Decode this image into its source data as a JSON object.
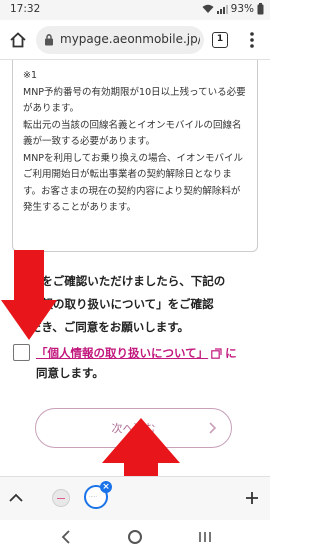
{
  "status_bar": {
    "time": "17:32",
    "battery": "93%"
  },
  "browser": {
    "url": "mypage.aeonmobile.jp/r",
    "tab_count": "1"
  },
  "notice": {
    "lines": [
      "※1",
      "MNP予約番号の有効期限が10日以上残っている必要があります。",
      "転出元の当該の回線名義とイオンモバイルの回線名義が一致する必要があります。",
      "MNPを利用してお乗り換えの場合、イオンモバイルご利用開始日が転出事業者の契約解除日となります。お客さまの現在の契約内容により契約解除料が発生することがあります。"
    ]
  },
  "consent": {
    "lead_text": "てをご確認いただけましたら、下記の\n情報の取り扱いについて」をご確認\nだき、ご同意をお願いします。",
    "link_text": "「個人情報の取り扱いについて」",
    "agree_prefix": "に",
    "agree_suffix": "同意します。",
    "checkbox_checked": false
  },
  "next_button": {
    "label": "次へ進む"
  },
  "colors": {
    "link": "#c2187e",
    "button_border": "#c8a0b8",
    "arrow": "#e8161b",
    "tab_accent": "#1a73e8"
  },
  "icons": {
    "home": "home-icon",
    "lock": "lock-icon",
    "menu": "more-vert-icon",
    "external": "external-link-icon",
    "chevron_right": "chevron-right-icon",
    "chevron_up": "chevron-up-icon",
    "plus": "plus-icon",
    "back": "back-icon",
    "nav_home": "nav-home-icon",
    "recents": "recents-icon"
  }
}
